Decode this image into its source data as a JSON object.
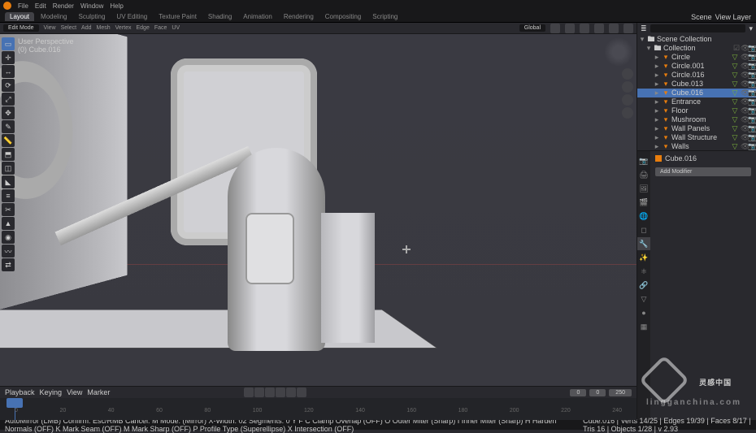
{
  "menu": {
    "items": [
      "File",
      "Edit",
      "Render",
      "Window",
      "Help"
    ]
  },
  "workspace_tabs": [
    "Layout",
    "Modeling",
    "Sculpting",
    "UV Editing",
    "Texture Paint",
    "Shading",
    "Animation",
    "Rendering",
    "Compositing",
    "Scripting"
  ],
  "workspace_active": "Layout",
  "top_right": {
    "scene_label": "Scene",
    "layer_label": "View Layer"
  },
  "viewport": {
    "mode": "Edit Mode",
    "menus": [
      "View",
      "Select",
      "Add",
      "Mesh",
      "Vertex",
      "Edge",
      "Face",
      "UV"
    ],
    "orientation": "Global",
    "overlay_view": "User Perspective",
    "overlay_obj": "(0) Cube.016",
    "snap_label": ""
  },
  "outliner": {
    "root": "Scene Collection",
    "collection": "Collection",
    "items": [
      {
        "name": "Circle",
        "sel": false
      },
      {
        "name": "Circle.001",
        "sel": false
      },
      {
        "name": "Circle.016",
        "sel": false
      },
      {
        "name": "Cube.013",
        "sel": false
      },
      {
        "name": "Cube.016",
        "sel": true
      },
      {
        "name": "Entrance",
        "sel": false
      },
      {
        "name": "Floor",
        "sel": false
      },
      {
        "name": "Mushroom",
        "sel": false
      },
      {
        "name": "Wall Panels",
        "sel": false
      },
      {
        "name": "Wall Structure",
        "sel": false
      },
      {
        "name": "Walls",
        "sel": false
      }
    ]
  },
  "properties": {
    "breadcrumb": "Cube.016",
    "add_modifier": "Add Modifier"
  },
  "timeline": {
    "menus": [
      "Playback",
      "Keying",
      "View",
      "Marker"
    ],
    "ticks": [
      "0",
      "20",
      "40",
      "60",
      "80",
      "100",
      "120",
      "140",
      "160",
      "180",
      "200",
      "220",
      "240"
    ],
    "current": "0",
    "start": "0",
    "end": "250"
  },
  "statusbar": {
    "left": "AutoMirror (LMB)  Confirm: Esc/RMB  Cancel: M  Mode: (Mirror)  X-Width: 02  Segments: 0  Y  F  C  Clamp Overlap (OFF)  O  Outer Miter (Sharp)  I  Inner Miter (Sharp)  H  Harden Normals (OFF)  K  Mark Seam (OFF)  M  Mark Sharp (OFF)  P  Profile Type (Superellipse)  X  Intersection (OFF)",
    "right": "Cube.016  |  Verts 14/25  |  Edges 19/39  |  Faces 8/17  |  Tris 16  |  Objects 1/28  |  v 2.93"
  },
  "watermark": {
    "text": "灵感中国",
    "sub": "lingganchina.com"
  }
}
